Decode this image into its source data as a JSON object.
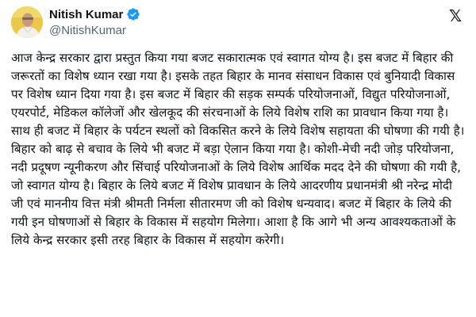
{
  "author": {
    "display_name": "Nitish Kumar",
    "handle": "@NitishKumar",
    "verified_icon": "verified-badge-icon",
    "avatar_icon": "profile-photo-avatar"
  },
  "platform_icon": "x-logo-icon",
  "colors": {
    "verified": "#1d9bf0",
    "text": "#0f1419",
    "secondary_text": "#536471",
    "avatar_bg": "#e9c84a"
  },
  "tweet": {
    "text": "आज केन्द्र सरकार द्वारा प्रस्तुत किया गया बजट सकारात्मक एवं स्वागत योग्य है। इस बजट में बिहार की जरूरतों का विशेष ध्यान रखा गया है। इसके तहत बिहार के मानव संसाधन विकास एवं बुनियादी विकास पर विशेष ध्यान दिया गया है। इस बजट में बिहार की सड़क सम्पर्क परियोजनाओं, विद्युत परियोजनाओं, एयरपोर्ट, मेडिकल कॉलेजों और खेलकूद की संरचनाओं के लिये विशेष राशि का प्रावधान किया गया है। साथ ही बजट में बिहार के पर्यटन स्थलों को विकसित करने के लिये विशेष सहायता की घोषणा की गयी है। बिहार को बाढ़ से बचाव के लिये भी बजट में बड़ा ऐलान किया गया है। कोशी-मेची नदी जोड़ परियोजना, नदी प्रदूषण न्यूनीकरण और सिंचाई परियोजनाओं के लिये विशेष आर्थिक मदद देने की घोषणा की गयी है, जो स्वागत योग्य है। बिहार के लिये बजट में विशेष प्रावधान के लिये आदरणीय प्रधानमंत्री श्री नरेन्द्र मोदी जी एवं माननीय वित्त मंत्री श्रीमती निर्मला सीतारमण जी को विशेष धन्यवाद। बजट में बिहार के लिये की गयी इन घोषणाओं से बिहार के विकास में सहयोग मिलेगा। आशा है कि आगे भी अन्य आवश्यकताओं के लिये केन्द्र सरकार इसी तरह बिहार के विकास में सहयोग करेगी।"
  }
}
